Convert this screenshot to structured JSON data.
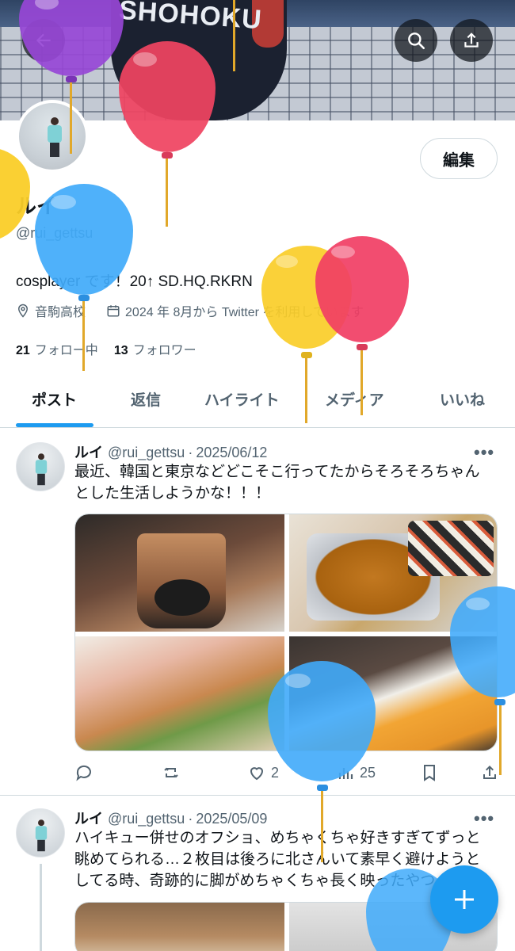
{
  "header": {
    "banner_shirt_text": "SHOHOKU",
    "search_icon": "search-icon",
    "share_icon": "share-icon",
    "back_icon": "back-arrow-icon"
  },
  "profile": {
    "edit_label": "編集",
    "display_name": "ルイ",
    "handle": "@rui_gettsu",
    "bio": "cosplayer です！20↑ SD.HQ.RKRN",
    "location": "音駒高校",
    "joined": "2024 年 8月から Twitter を利用しています",
    "following_count": "21",
    "following_label": "フォロー中",
    "followers_count": "13",
    "followers_label": "フォロワー"
  },
  "tabs": [
    {
      "label": "ポスト"
    },
    {
      "label": "返信"
    },
    {
      "label": "ハイライト"
    },
    {
      "label": "メディア"
    },
    {
      "label": "いいね"
    }
  ],
  "posts": [
    {
      "name": "ルイ",
      "handle": "@rui_gettsu",
      "date": "2025/06/12",
      "text": "最近、韓国と東京などどこそこ行ってたからそろそろちゃんとした生活しようかな！！！",
      "likes": "2",
      "views": "25",
      "more": "•••"
    },
    {
      "name": "ルイ",
      "handle": "@rui_gettsu",
      "date": "2025/05/09",
      "text": "ハイキュー併せのオフショ、めちゃくちゃ好きすぎてずっと眺めてられる…２枚目は後ろに北さんいて素早く避けようとしてる時、奇跡的に脚がめちゃくちゃ長く映ったやつ",
      "more": "•••"
    }
  ],
  "colors": {
    "accent": "#1d9bf0",
    "text": "#0f1419",
    "muted": "#536471",
    "border": "#cfd9de"
  }
}
